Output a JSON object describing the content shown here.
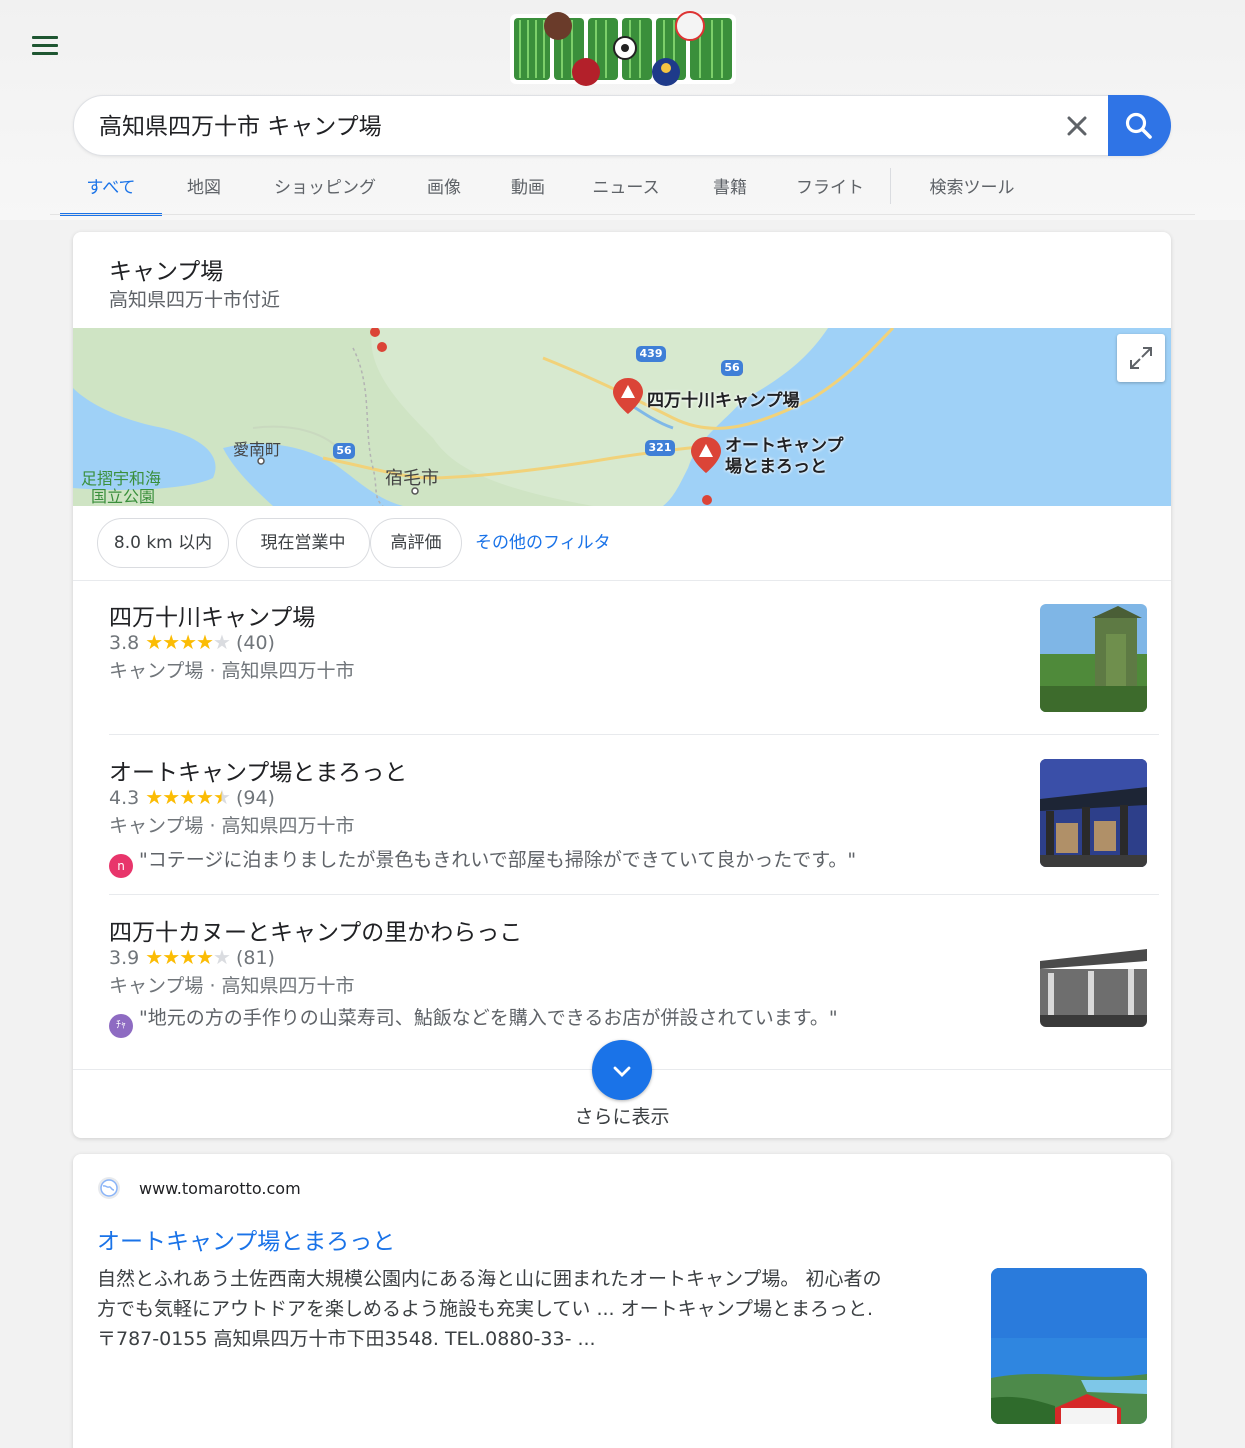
{
  "search": {
    "query": "高知県四万十市 キャンプ場",
    "logo_label": "Google Doodle"
  },
  "tabs": [
    {
      "label": "すべて",
      "active": true
    },
    {
      "label": "地図"
    },
    {
      "label": "ショッピング"
    },
    {
      "label": "画像"
    },
    {
      "label": "動画"
    },
    {
      "label": "ニュース"
    },
    {
      "label": "書籍"
    },
    {
      "label": "フライト"
    },
    {
      "label": "検索ツール"
    }
  ],
  "local": {
    "title": "キャンプ場",
    "subtitle": "高知県四万十市付近",
    "map": {
      "labels": {
        "pin1": "四万十川キャンプ場",
        "pin2_line1": "オートキャンプ",
        "pin2_line2": "場とまろっと",
        "town1": "愛南町",
        "town2": "宿毛市",
        "park_line1": "足摺宇和海",
        "park_line2": "国立公園",
        "road1": "439",
        "road2": "56",
        "road3": "321",
        "road4": "56"
      }
    },
    "filters": [
      "8.0 km 以内",
      "現在営業中",
      "高評価"
    ],
    "more_filters": "その他のフィルタ",
    "results": [
      {
        "name": "四万十川キャンプ場",
        "rating": "3.8",
        "stars": 3.8,
        "reviews": "(40)",
        "type": "キャンプ場 · 高知県四万十市",
        "review_text": ""
      },
      {
        "name": "オートキャンプ場とまろっと",
        "rating": "4.3",
        "stars": 4.3,
        "reviews": "(94)",
        "type": "キャンプ場 · 高知県四万十市",
        "review_avatar": "n",
        "review_text": "\"コテージに泊まりましたが景色もきれいで部屋も掃除ができていて良かったです。\""
      },
      {
        "name": "四万十カヌーとキャンプの里かわらっこ",
        "rating": "3.9",
        "stars": 3.9,
        "reviews": "(81)",
        "type": "キャンプ場 · 高知県四万十市",
        "review_avatar": "ﾁｬ",
        "review_text": "\"地元の方の手作りの山菜寿司、鮎飯などを購入できるお店が併設されています。\""
      }
    ],
    "more_label": "さらに表示"
  },
  "web_result": {
    "url": "www.tomarotto.com",
    "title": "オートキャンプ場とまろっと",
    "snippet_line1": "自然とふれあう土佐西南大規模公園内にある海と山に囲まれたオートキャンプ場。 初心者の",
    "snippet_line2": "方でも気軽にアウトドアを楽しめるよう施設も充実してい ... オートキャンプ場とまろっと.",
    "snippet_line3": "〒787-0155 高知県四万十市下田3548. TEL.0880-33- ..."
  },
  "colors": {
    "accent": "#1a73e8",
    "search_button": "#2f74e6",
    "star": "#fbbc04",
    "map_sea": "#9fd1f7",
    "map_land": "#d8ead0"
  }
}
